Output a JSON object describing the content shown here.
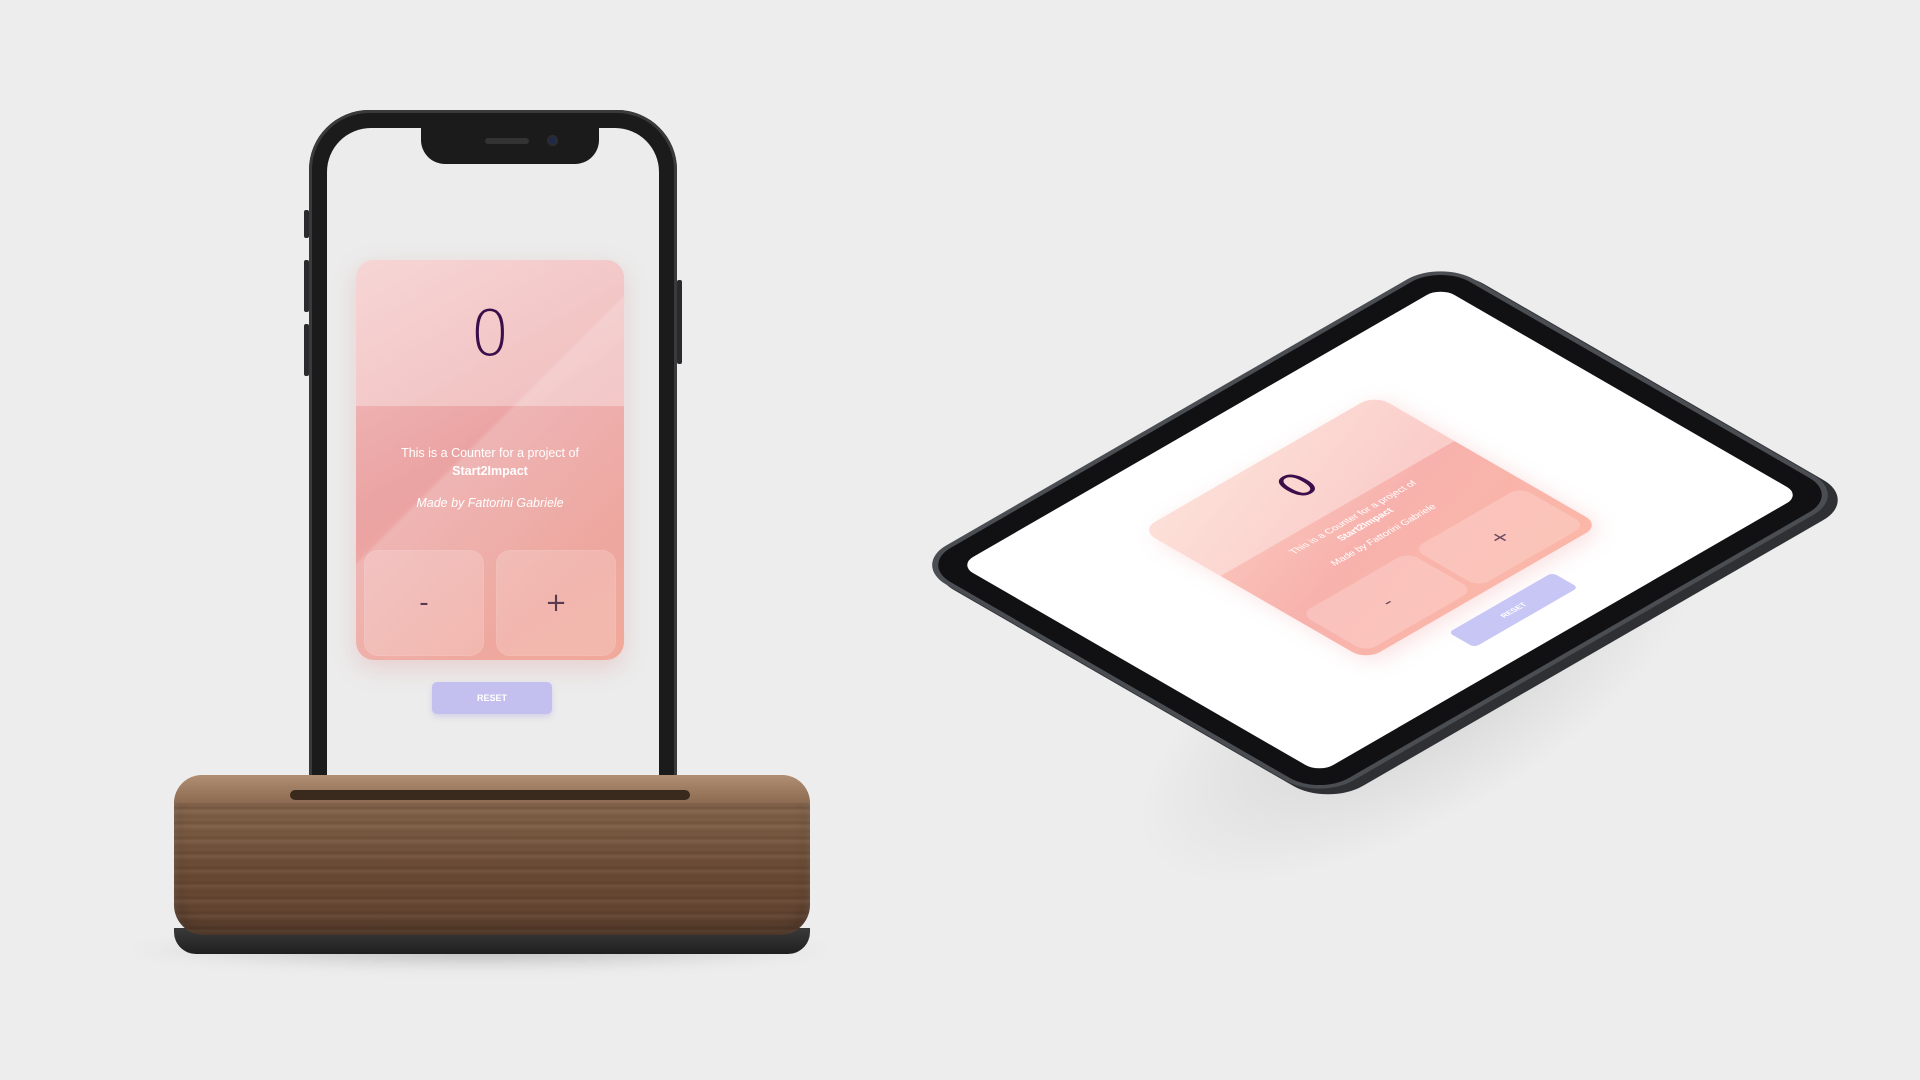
{
  "phone_app": {
    "counter_value": "0",
    "description": "This is a Counter for a project of",
    "project_name": "Start2Impact",
    "author": "Made by Fattorini Gabriele",
    "decrement_label": "-",
    "increment_label": "+",
    "reset_label": "RESET"
  },
  "tablet_app": {
    "counter_value": "0",
    "description": "This is a Counter for a project of",
    "project_name": "Start2Impact",
    "author": "Made by Fattorini Gabriele",
    "decrement_label": "-",
    "increment_label": "+",
    "reset_label": "RESET"
  },
  "colors": {
    "background": "#ededed",
    "card_pink": "#eba4a4",
    "counter_text": "#3a0e4a",
    "reset_button": "#c3c0ef",
    "dock_wood": "#7a5a42",
    "device_frame": "#1b1b1c"
  }
}
